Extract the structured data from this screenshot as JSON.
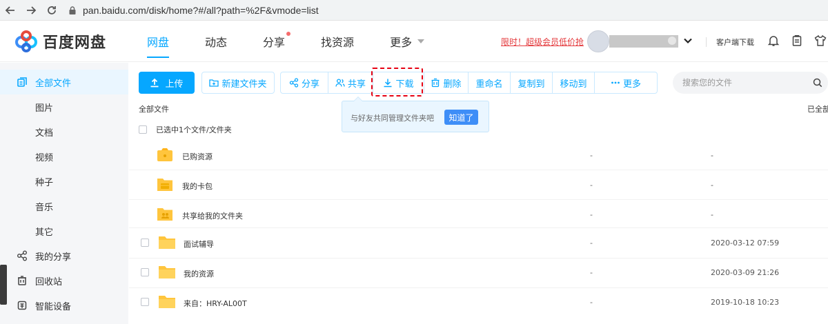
{
  "browser": {
    "url": "pan.baidu.com/disk/home?#/all?path=%2F&vmode=list"
  },
  "header": {
    "logo_text": "百度网盘",
    "nav": [
      {
        "label": "网盘",
        "active": true
      },
      {
        "label": "动态"
      },
      {
        "label": "分享",
        "dot": true
      },
      {
        "label": "找资源"
      },
      {
        "label": "更多",
        "caret": true
      }
    ],
    "promo": "限时！超级会员低价抢",
    "client_download": "客户端下载"
  },
  "sidebar": {
    "items": [
      {
        "label": "全部文件",
        "icon": "files-icon",
        "active": true
      },
      {
        "label": "图片"
      },
      {
        "label": "文档"
      },
      {
        "label": "视频"
      },
      {
        "label": "种子"
      },
      {
        "label": "音乐"
      },
      {
        "label": "其它"
      },
      {
        "label": "我的分享",
        "icon": "share-icon"
      },
      {
        "label": "回收站",
        "icon": "recycle-bin-icon"
      },
      {
        "label": "智能设备",
        "icon": "smart-device-icon"
      }
    ]
  },
  "toolbar": {
    "upload": "上传",
    "new_folder": "新建文件夹",
    "group": [
      "分享",
      "共享",
      "下载",
      "删除",
      "重命名",
      "复制到",
      "移动到",
      "更多"
    ],
    "search_placeholder": "搜索您的文件"
  },
  "breadcrumb": "全部文件",
  "loaded_all": "已全部",
  "tooltip": {
    "text": "与好友共同管理文件夹吧",
    "button": "知道了"
  },
  "select_all": "已选中1个文件/文件夹",
  "files": [
    {
      "name": "已购资源",
      "size": "-",
      "date": "-",
      "icon": "purchased-folder-icon"
    },
    {
      "name": "我的卡包",
      "size": "-",
      "date": "-",
      "icon": "card-folder-icon"
    },
    {
      "name": "共享给我的文件夹",
      "size": "-",
      "date": "-",
      "icon": "shared-folder-icon"
    },
    {
      "name": "面试辅导",
      "size": "-",
      "date": "2020-03-12 07:59",
      "icon": "folder-icon"
    },
    {
      "name": "我的资源",
      "size": "-",
      "date": "2020-03-09 21:26",
      "icon": "folder-icon"
    },
    {
      "name": "来自：HRY-AL00T",
      "size": "-",
      "date": "2019-10-18 10:23",
      "icon": "folder-icon"
    }
  ],
  "colors": {
    "accent": "#06a7ff",
    "highlight_box": "#e60012",
    "promo": "#e4393c",
    "folder": "#ffc53d"
  }
}
